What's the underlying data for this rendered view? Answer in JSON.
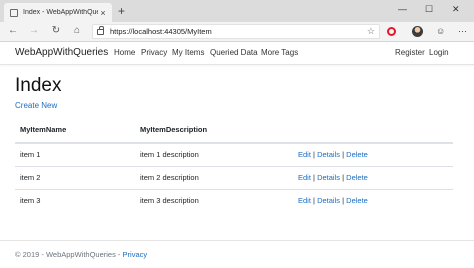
{
  "browser": {
    "tab_title": "Index - WebAppWithQueries",
    "tab_close": "×",
    "new_tab": "+",
    "window_min": "—",
    "window_max": "☐",
    "window_close": "✕",
    "url": "https://localhost:44305/MyItem"
  },
  "navbar": {
    "brand": "WebAppWithQueries",
    "links": [
      "Home",
      "Privacy",
      "My Items",
      "Queried Data",
      "More Tags"
    ],
    "register": "Register",
    "login": "Login"
  },
  "page": {
    "title": "Index",
    "create_new": "Create New"
  },
  "table": {
    "headers": [
      "MyItemName",
      "MyItemDescription"
    ],
    "rows": [
      {
        "name": "item 1",
        "description": "item 1 description"
      },
      {
        "name": "item 2",
        "description": "item 2 description"
      },
      {
        "name": "item 3",
        "description": "item 3 description"
      }
    ],
    "actions": {
      "edit": "Edit",
      "details": "Details",
      "delete": "Delete",
      "sep": "|"
    }
  },
  "footer": {
    "text": "© 2019 - WebAppWithQueries - ",
    "privacy": "Privacy"
  }
}
